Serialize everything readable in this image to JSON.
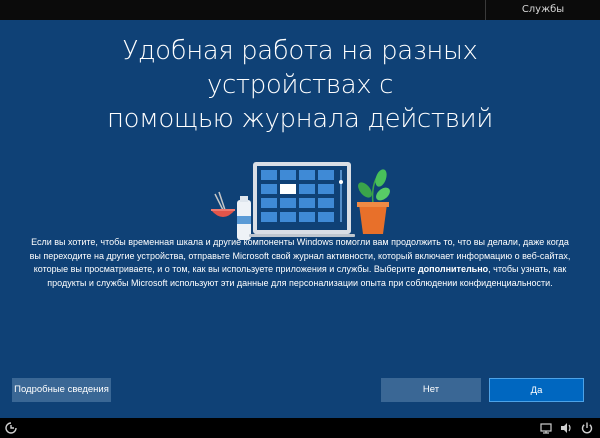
{
  "header": {
    "tab_label": "Службы"
  },
  "page": {
    "title_line1": "Удобная работа на разных устройствах с",
    "title_line2": "помощью журнала действий",
    "body": {
      "part1": "Если вы хотите, чтобы временная шкала и другие компоненты Windows помогли вам продолжить то, что вы делали, даже когда вы переходите на другие устройства, отправьте Microsoft свой журнал активности, который включает информацию о веб-сайтах, которые вы просматриваете, и о том, как вы используете приложения и службы. Выберите ",
      "bold": "дополнительно",
      "part2": ", чтобы узнать, как продукты и службы Microsoft используют эти данные для персонализации опыта при соблюдении конфиденциальности."
    }
  },
  "buttons": {
    "details": "Подробные сведения",
    "no": "Нет",
    "yes": "Да"
  },
  "taskbar": {
    "left_icon": "accessibility-icon",
    "right_icons": [
      "network-icon",
      "volume-icon",
      "power-icon"
    ]
  },
  "colors": {
    "background": "#0f4176",
    "button": "#3a6795",
    "primary_button": "#0067c0"
  }
}
